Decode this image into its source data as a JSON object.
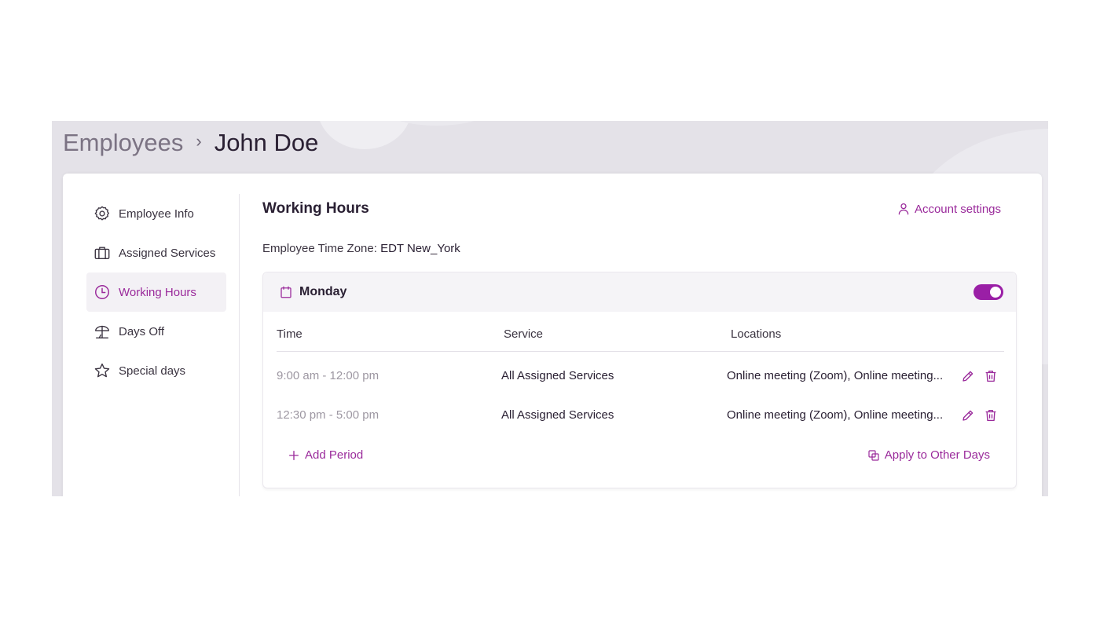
{
  "breadcrumb": {
    "root": "Employees",
    "separator": "›",
    "current": "John Doe"
  },
  "sidebar": {
    "items": [
      {
        "label": "Employee Info",
        "icon": "gear-icon",
        "active": false
      },
      {
        "label": "Assigned Services",
        "icon": "briefcase-icon",
        "active": false
      },
      {
        "label": "Working Hours",
        "icon": "clock-icon",
        "active": true
      },
      {
        "label": "Days Off",
        "icon": "beach-umbrella-icon",
        "active": false
      },
      {
        "label": "Special days",
        "icon": "star-icon",
        "active": false
      }
    ]
  },
  "main": {
    "title": "Working Hours",
    "account_settings": "Account settings",
    "timezone_label": "Employee Time Zone:",
    "timezone_value": "EDT New_York"
  },
  "day": {
    "name": "Monday",
    "enabled": true,
    "columns": {
      "time": "Time",
      "service": "Service",
      "locations": "Locations"
    },
    "periods": [
      {
        "time": "9:00 am - 12:00 pm",
        "service": "All Assigned Services",
        "locations": "Online meeting (Zoom), Online meeting..."
      },
      {
        "time": "12:30 pm - 5:00 pm",
        "service": "All Assigned Services",
        "locations": "Online meeting (Zoom), Online meeting..."
      }
    ],
    "add_period": "Add Period",
    "apply_other_days": "Apply to Other Days"
  },
  "colors": {
    "accent": "#9a2a9b",
    "toggle": "#9a1fa6",
    "frame_bg": "#e4e2e8"
  }
}
